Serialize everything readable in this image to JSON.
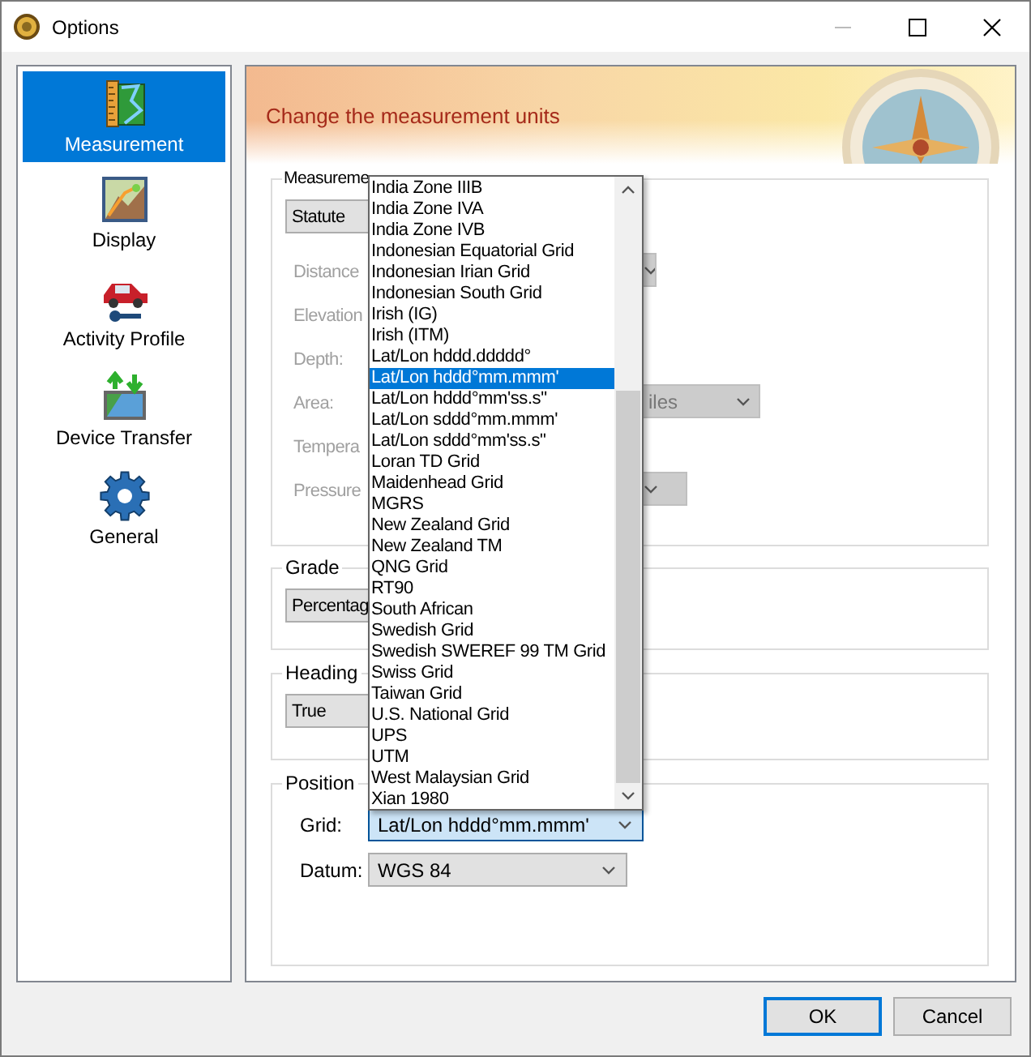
{
  "window": {
    "title": "Options"
  },
  "sidebar": {
    "items": [
      {
        "label": "Measurement",
        "kind": "measurement",
        "selected": true
      },
      {
        "label": "Display",
        "kind": "display",
        "selected": false
      },
      {
        "label": "Activity Profile",
        "kind": "profile",
        "selected": false
      },
      {
        "label": "Device Transfer",
        "kind": "transfer",
        "selected": false
      },
      {
        "label": "General",
        "kind": "general",
        "selected": false
      }
    ]
  },
  "header": {
    "title": "Change the measurement units"
  },
  "measurement_system": {
    "label": "Measureme",
    "system": "Statute",
    "rows": [
      {
        "label": "Distance",
        "kind": "combo",
        "disabled": true
      },
      {
        "label": "Elevation",
        "kind": "plain",
        "disabled": true
      },
      {
        "label": "Depth:",
        "kind": "plain",
        "disabled": true
      },
      {
        "label": "Area:",
        "kind": "combo",
        "value": "iles",
        "disabled": true
      },
      {
        "label": "Tempera",
        "kind": "plain",
        "disabled": true
      },
      {
        "label": "Pressure",
        "kind": "combo",
        "disabled": true
      }
    ]
  },
  "grade": {
    "label": "Grade",
    "value": "Percentag"
  },
  "heading": {
    "label": "Heading",
    "value": "True"
  },
  "position": {
    "label": "Position",
    "grid": {
      "label": "Grid:",
      "value": "Lat/Lon hddd°mm.mmm'",
      "open": true
    },
    "datum": {
      "label": "Datum:",
      "value": "WGS 84"
    }
  },
  "grid_dropdown": {
    "items": [
      {
        "label": "India Zone IIIB",
        "selected": false
      },
      {
        "label": "India Zone IVA",
        "selected": false
      },
      {
        "label": "India Zone IVB",
        "selected": false
      },
      {
        "label": "Indonesian Equatorial Grid",
        "selected": false
      },
      {
        "label": "Indonesian Irian Grid",
        "selected": false
      },
      {
        "label": "Indonesian South Grid",
        "selected": false
      },
      {
        "label": "Irish (IG)",
        "selected": false
      },
      {
        "label": "Irish (ITM)",
        "selected": false
      },
      {
        "label": "Lat/Lon hddd.ddddd°",
        "selected": false
      },
      {
        "label": "Lat/Lon hddd°mm.mmm'",
        "selected": true
      },
      {
        "label": "Lat/Lon hddd°mm'ss.s\"",
        "selected": false
      },
      {
        "label": "Lat/Lon sddd°mm.mmm'",
        "selected": false
      },
      {
        "label": "Lat/Lon sddd°mm'ss.s\"",
        "selected": false
      },
      {
        "label": "Loran TD Grid",
        "selected": false
      },
      {
        "label": "Maidenhead Grid",
        "selected": false
      },
      {
        "label": "MGRS",
        "selected": false
      },
      {
        "label": "New Zealand Grid",
        "selected": false
      },
      {
        "label": "New Zealand TM",
        "selected": false
      },
      {
        "label": "QNG Grid",
        "selected": false
      },
      {
        "label": "RT90",
        "selected": false
      },
      {
        "label": "South African",
        "selected": false
      },
      {
        "label": "Swedish Grid",
        "selected": false
      },
      {
        "label": "Swedish SWEREF 99 TM Grid",
        "selected": false
      },
      {
        "label": "Swiss Grid",
        "selected": false
      },
      {
        "label": "Taiwan Grid",
        "selected": false
      },
      {
        "label": "U.S. National Grid",
        "selected": false
      },
      {
        "label": "UPS",
        "selected": false
      },
      {
        "label": "UTM",
        "selected": false
      },
      {
        "label": "West Malaysian Grid",
        "selected": false
      },
      {
        "label": "Xian 1980",
        "selected": false
      }
    ]
  },
  "buttons": [
    {
      "label": "OK",
      "default": true
    },
    {
      "label": "Cancel",
      "default": false
    }
  ]
}
